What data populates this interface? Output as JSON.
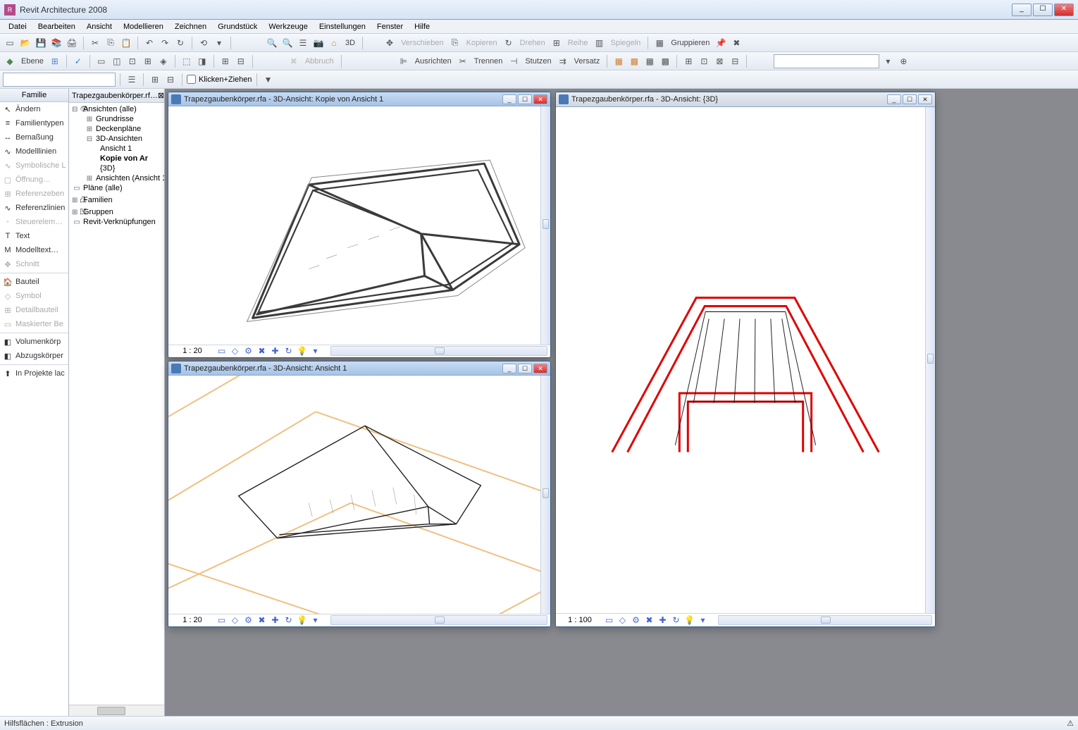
{
  "app": {
    "title": "Revit Architecture 2008"
  },
  "menu": [
    "Datei",
    "Bearbeiten",
    "Ansicht",
    "Modellieren",
    "Zeichnen",
    "Grundstück",
    "Werkzeuge",
    "Einstellungen",
    "Fenster",
    "Hilfe"
  ],
  "toolbar1": {
    "ebene": "Ebene",
    "group": "Gruppieren",
    "labels": {
      "verschieben": "Verschieben",
      "kopieren": "Kopieren",
      "drehen": "Drehen",
      "reihe": "Reihe",
      "spiegeln": "Spiegeln",
      "3d": "3D"
    }
  },
  "toolbar2": {
    "abbruch": "Abbruch",
    "ausrichten": "Ausrichten",
    "trennen": "Trennen",
    "stutzen": "Stutzen",
    "versatz": "Versatz"
  },
  "toolbar3": {
    "klickzieh": "Klicken+Ziehen"
  },
  "sidebar": {
    "head": "Familie",
    "items": [
      {
        "label": "Ändern",
        "disabled": false,
        "ico": "↖"
      },
      {
        "label": "Familientypen",
        "disabled": false,
        "ico": "≡"
      },
      {
        "label": "Bemaßung",
        "disabled": false,
        "ico": "↔"
      },
      {
        "label": "Modelllinien",
        "disabled": false,
        "ico": "∿"
      },
      {
        "label": "Symbolische L",
        "disabled": true,
        "ico": "∿"
      },
      {
        "label": "Öffnung…",
        "disabled": true,
        "ico": "▢"
      },
      {
        "label": "Referenzeben",
        "disabled": true,
        "ico": "⊞"
      },
      {
        "label": "Referenzlinien",
        "disabled": false,
        "ico": "∿"
      },
      {
        "label": "Steuerelem…",
        "disabled": true,
        "ico": "◦"
      },
      {
        "label": "Text",
        "disabled": false,
        "ico": "T"
      },
      {
        "label": "Modelltext…",
        "disabled": false,
        "ico": "M"
      },
      {
        "label": "Schnitt",
        "disabled": true,
        "ico": "✥"
      },
      {
        "sep": true
      },
      {
        "label": "Bauteil",
        "disabled": false,
        "ico": "🏠"
      },
      {
        "label": "Symbol",
        "disabled": true,
        "ico": "◇"
      },
      {
        "label": "Detailbauteil",
        "disabled": true,
        "ico": "⊞"
      },
      {
        "label": "Maskierter Be",
        "disabled": true,
        "ico": "▭"
      },
      {
        "sep": true
      },
      {
        "label": "Volumenkörp",
        "disabled": false,
        "ico": "◧"
      },
      {
        "label": "Abzugskörper",
        "disabled": false,
        "ico": "◧"
      },
      {
        "sep": true
      },
      {
        "label": "In Projekte lac",
        "disabled": false,
        "ico": "⬆"
      }
    ]
  },
  "browser": {
    "tab": "Trapezgaubenkörper.rf…⊠",
    "tree": [
      {
        "label": "Ansichten (alle)",
        "indent": 0,
        "icon": "⊟ 👁",
        "bold": false
      },
      {
        "label": "Grundrisse",
        "indent": 1,
        "icon": "⊞",
        "bold": false
      },
      {
        "label": "Deckenpläne",
        "indent": 1,
        "icon": "⊞",
        "bold": false
      },
      {
        "label": "3D-Ansichten",
        "indent": 1,
        "icon": "⊟",
        "bold": false
      },
      {
        "label": "Ansicht 1",
        "indent": 2,
        "icon": "",
        "bold": false
      },
      {
        "label": "Kopie von Ar",
        "indent": 2,
        "icon": "",
        "bold": true
      },
      {
        "label": "{3D}",
        "indent": 2,
        "icon": "",
        "bold": false
      },
      {
        "label": "Ansichten (Ansicht 1",
        "indent": 1,
        "icon": "⊞",
        "bold": false
      },
      {
        "label": "Pläne (alle)",
        "indent": 0,
        "icon": "▭",
        "bold": false
      },
      {
        "label": "Familien",
        "indent": 0,
        "icon": "⊞ 凸",
        "bold": false
      },
      {
        "label": "Gruppen",
        "indent": 0,
        "icon": "⊞ 凹",
        "bold": false
      },
      {
        "label": "Revit-Verknüpfungen",
        "indent": 0,
        "icon": "▭",
        "bold": false
      }
    ]
  },
  "views": {
    "v1": {
      "title": "Trapezgaubenkörper.rfa - 3D-Ansicht: Kopie von Ansicht 1",
      "scale": "1 : 20"
    },
    "v2": {
      "title": "Trapezgaubenkörper.rfa - 3D-Ansicht: Ansicht 1",
      "scale": "1 : 20"
    },
    "v3": {
      "title": "Trapezgaubenkörper.rfa - 3D-Ansicht: {3D}",
      "scale": "1 : 100"
    }
  },
  "status": {
    "text": "Hilfsflächen : Extrusion"
  }
}
